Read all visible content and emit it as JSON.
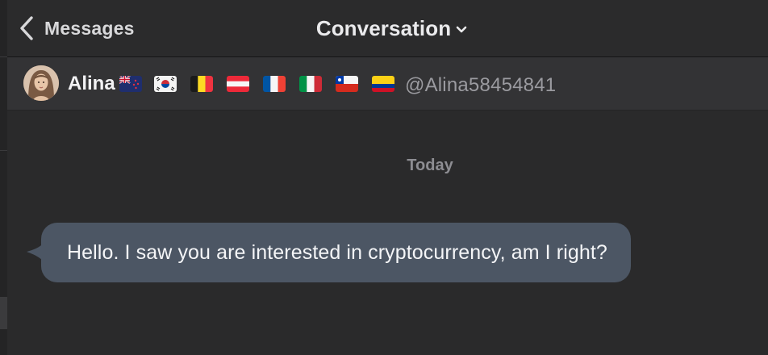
{
  "header": {
    "back_label": "Messages",
    "title": "Conversation"
  },
  "profile": {
    "name": "Alina",
    "handle": "@Alina58454841",
    "flags": [
      "new-zealand-flag",
      "south-korea-flag",
      "belgium-flag",
      "austria-flag",
      "france-flag",
      "italy-flag",
      "chile-flag",
      "colombia-flag"
    ]
  },
  "conversation": {
    "date_separator": "Today",
    "messages": [
      {
        "text": "Hello. I saw you are interested in cryptocurrency, am I right?"
      }
    ]
  },
  "colors": {
    "background": "#2a2a2b",
    "profile_bar": "#333335",
    "bubble": "#4c5664"
  }
}
